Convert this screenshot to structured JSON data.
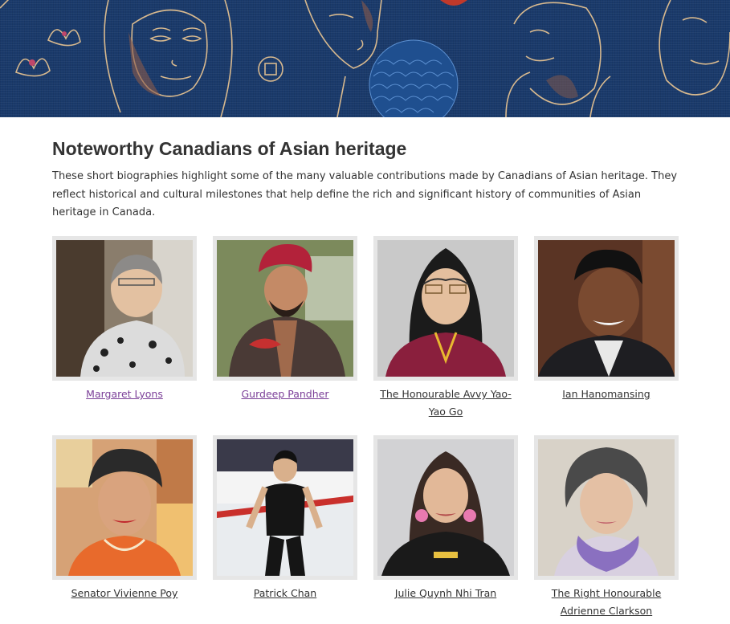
{
  "banner": {
    "name": "Asian Heritage Month banner",
    "colors": {
      "background": "#1a3a6b",
      "line_art": "#d8b98e",
      "accent": "#c0392b"
    },
    "icons": [
      "faces-line-art",
      "lotus-flower-icon",
      "coin-symbol-icon",
      "wave-pattern-circle-icon"
    ]
  },
  "page": {
    "title": "Noteworthy Canadians of Asian heritage",
    "intro": "These short biographies highlight some of the many valuable contributions made by Canadians of Asian heritage. They reflect historical and cultural milestones that help define the rich and significant history of communities of Asian heritage in Canada."
  },
  "people": [
    {
      "name": "Margaret Lyons",
      "visited": true
    },
    {
      "name": "Gurdeep Pandher",
      "visited": true
    },
    {
      "name": "The Honourable Avvy Yao-Yao Go",
      "visited": false
    },
    {
      "name": "Ian Hanomansing",
      "visited": false
    },
    {
      "name": "Senator Vivienne Poy",
      "visited": false
    },
    {
      "name": "Patrick Chan",
      "visited": false
    },
    {
      "name": "Julie Quynh Nhi Tran",
      "visited": false
    },
    {
      "name": "The Right Honourable Adrienne Clarkson",
      "visited": false
    }
  ],
  "colors": {
    "link": "#333333",
    "visited_link": "#7b3f98",
    "frame": "#e6e6e6"
  }
}
